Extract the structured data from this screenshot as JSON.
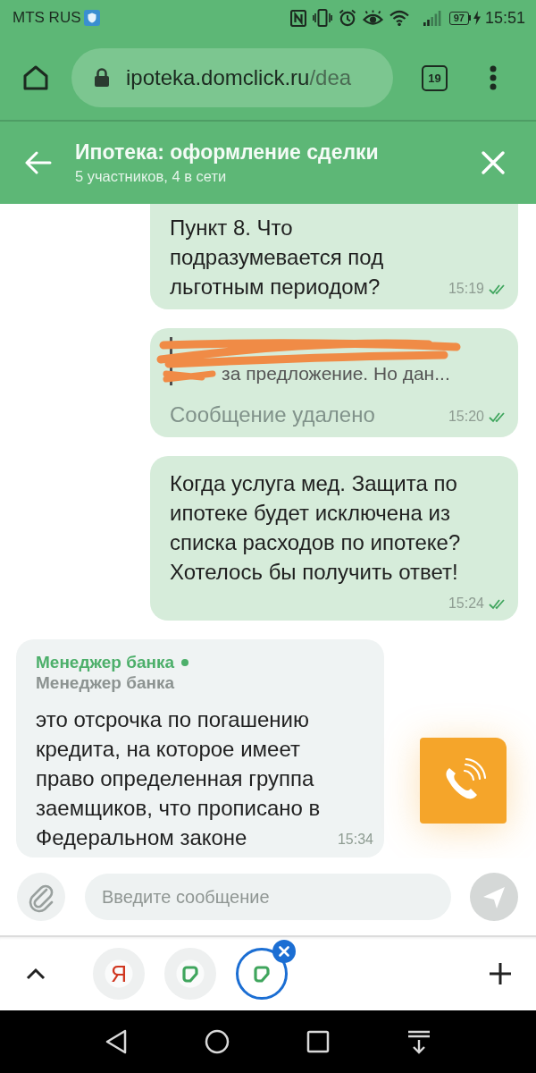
{
  "status_bar": {
    "carrier": "MTS RUS",
    "battery": "97",
    "time": "15:51"
  },
  "browser": {
    "url_host": "ipoteka.domclick.ru",
    "url_path": "/dea",
    "tab_count": "19"
  },
  "chat_header": {
    "title": "Ипотека: оформление сделки",
    "subtitle": "5 участников, 4 в сети"
  },
  "messages": [
    {
      "kind": "outgoing",
      "text": "Пункт 8. Что подразумевается под льготным периодом?",
      "time": "15:19",
      "read": true
    },
    {
      "kind": "deleted",
      "quote": "за предложение. Но дан...",
      "text": "Сообщение удалено",
      "time": "15:20",
      "read": true
    },
    {
      "kind": "outgoing",
      "text": "Когда услуга мед. Защита по ипотеке будет исключена из списка расходов по ипотеке? Хотелось бы получить ответ!",
      "time": "15:24",
      "read": true
    },
    {
      "kind": "incoming",
      "sender": "Менеджер банка",
      "online": true,
      "role": "Менеджер банка",
      "text": "это отсрочка по погашению кредита, на которое имеет право определенная группа заемщиков, что прописано в Федеральном законе",
      "time": "15:34"
    }
  ],
  "composer": {
    "placeholder": "Введите сообщение"
  },
  "tab_strip": {
    "tabs": [
      {
        "kind": "yandex",
        "label": "Я",
        "selected": false
      },
      {
        "kind": "domclick",
        "selected": false
      },
      {
        "kind": "domclick",
        "selected": true
      }
    ]
  }
}
